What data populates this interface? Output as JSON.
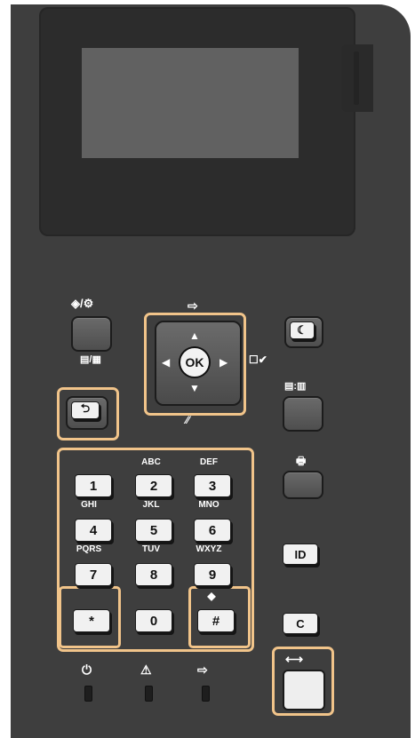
{
  "display": {
    "state": "blank"
  },
  "top_buttons": {
    "settings_label": "◈/⚙",
    "home_icon_label": "⇨",
    "sleep_label": "☾",
    "status_monitor_label": "▤/▦",
    "paper_label": "☐✔"
  },
  "dpad": {
    "ok_label": "OK",
    "up": "▲",
    "down": "▼",
    "left": "◀",
    "right": "▶",
    "clear_slash": "⁄⁄"
  },
  "side_buttons": {
    "menu_label": "▤:▥",
    "energy_label": "🖶",
    "id_label": "ID",
    "clear_label": "C",
    "start_label": "⟷"
  },
  "keypad": {
    "keys": [
      {
        "digit": "1",
        "letters": ""
      },
      {
        "digit": "2",
        "letters": "ABC"
      },
      {
        "digit": "3",
        "letters": "DEF"
      },
      {
        "digit": "4",
        "letters": "GHI"
      },
      {
        "digit": "5",
        "letters": "JKL"
      },
      {
        "digit": "6",
        "letters": "MNO"
      },
      {
        "digit": "7",
        "letters": "PQRS"
      },
      {
        "digit": "8",
        "letters": "TUV"
      },
      {
        "digit": "9",
        "letters": "WXYZ"
      },
      {
        "digit": "*",
        "letters": ""
      },
      {
        "digit": "0",
        "letters": ""
      },
      {
        "digit": "#",
        "letters": "◆"
      }
    ]
  },
  "indicators": [
    {
      "name": "power",
      "symbol": "⏻"
    },
    {
      "name": "error",
      "symbol": "⚠"
    },
    {
      "name": "data",
      "symbol": "⇨"
    }
  ],
  "colors": {
    "panel": "#3e3e3e",
    "highlight": "#f1c48a",
    "key_face": "#f1f1f1"
  }
}
